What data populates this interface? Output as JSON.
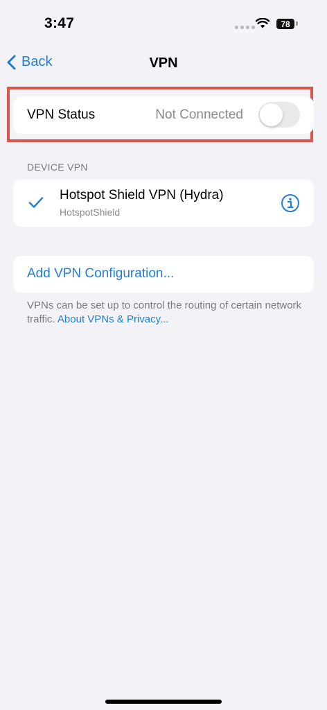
{
  "status_bar": {
    "time": "3:47",
    "battery": "78"
  },
  "nav": {
    "back_label": "Back",
    "title": "VPN"
  },
  "vpn_status": {
    "label": "VPN Status",
    "value": "Not Connected",
    "toggle_on": false
  },
  "device_vpn": {
    "header": "DEVICE VPN",
    "items": [
      {
        "name": "Hotspot Shield VPN (Hydra)",
        "subtitle": "HotspotShield",
        "selected": true
      }
    ]
  },
  "add_config": {
    "label": "Add VPN Configuration..."
  },
  "footnote": {
    "text": "VPNs can be set up to control the routing of certain network traffic. ",
    "link": "About VPNs & Privacy..."
  },
  "colors": {
    "accent": "#1f7ed4",
    "highlight_border": "#d9564a",
    "background": "#f2f2f7",
    "secondary_text": "#8a8a8e"
  },
  "icons": {
    "back": "chevron-left-icon",
    "check": "checkmark-icon",
    "info": "info-circle-icon",
    "wifi": "wifi-icon"
  }
}
